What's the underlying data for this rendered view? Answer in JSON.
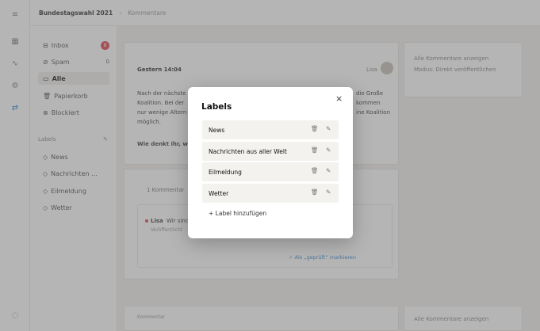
{
  "topbar": {
    "title": "Bundestagswahl 2021",
    "separator": "›",
    "crumb": "Kommentare"
  },
  "sidebar": {
    "items": [
      {
        "label": "Inbox",
        "icon": "inbox-icon",
        "count": "8"
      },
      {
        "label": "Spam",
        "icon": "spam-icon",
        "count": "0"
      },
      {
        "label": "Alle",
        "icon": "archive-icon",
        "count": ""
      },
      {
        "label": "Papierkorb",
        "icon": "trash-icon",
        "count": ""
      },
      {
        "label": "Blockiert",
        "icon": "block-icon",
        "count": ""
      }
    ],
    "labels_heading": "Labels",
    "labels_edit": "✎",
    "label_items": [
      "News",
      "Nachrichten ...",
      "Eilmeldung",
      "Wetter"
    ]
  },
  "main": {
    "comment_time": "Gestern 14:04",
    "comment_user": "Lisa",
    "comment_text_1": "Nach der nächste",
    "comment_text_2": "Koalition. Bei der",
    "comment_text_3": "nur wenige Altern",
    "comment_text_4": "möglich.",
    "comment_right_1": "die Große",
    "comment_right_2": "kommen",
    "comment_right_3": "ine Koalition",
    "question": "Wie denkt ihr, w",
    "replies": "1 Kommentar",
    "reply_user": "Lisa",
    "reply_text": "Wir sind",
    "reply_status": "Veröffentlicht",
    "mark_checked": "✓ Als „geprüft“ markieren",
    "options_1": "Alle Kommentare anzeigen",
    "options_2": "Modus: Direkt veröffentlichen",
    "bottom_left": "Kommentar",
    "bottom_right": "Alle Kommentare anzeigen"
  },
  "modal": {
    "title": "Labels",
    "close": "×",
    "labels": [
      "News",
      "Nachrichten aus aller Welt",
      "Eilmeldung",
      "Wetter"
    ],
    "delete_icon": "🗑",
    "edit_icon": "✎",
    "add_label": "+ Label hinzufügen"
  },
  "colors": {
    "accent": "#e04b55",
    "overlay": "#5a5a5a",
    "row_bg": "#f4f2ef"
  }
}
